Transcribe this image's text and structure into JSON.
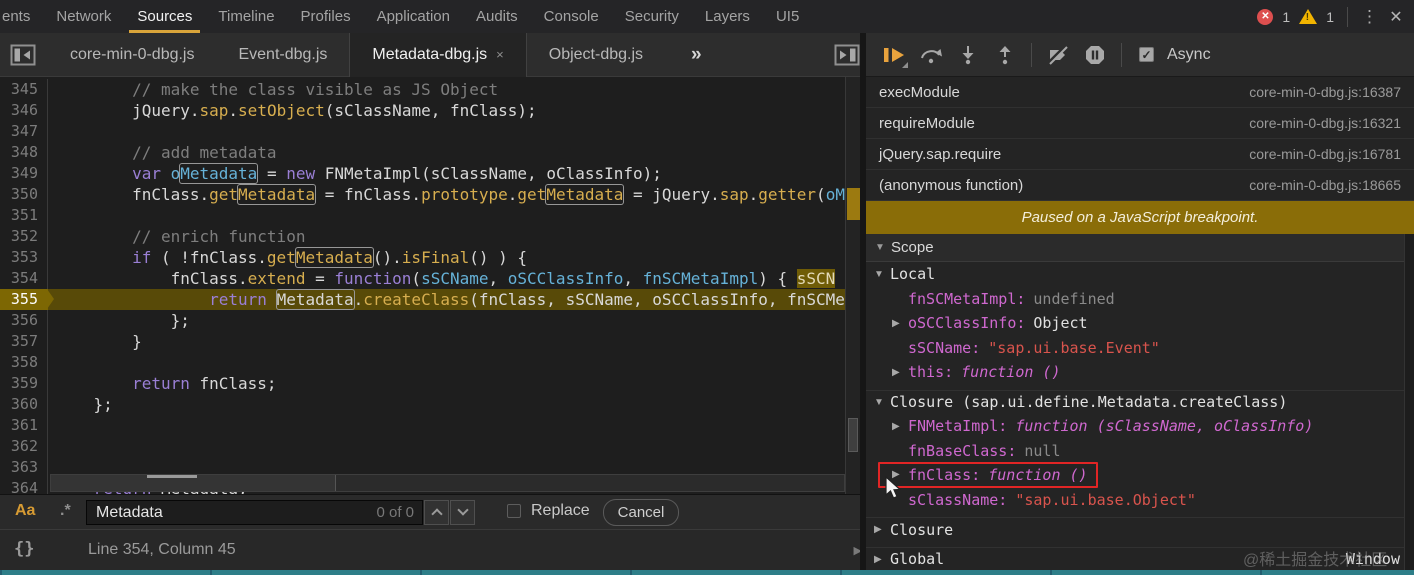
{
  "topbar": {
    "tabs": [
      {
        "label": "ents",
        "active": false
      },
      {
        "label": "Network",
        "active": false
      },
      {
        "label": "Sources",
        "active": true
      },
      {
        "label": "Timeline",
        "active": false
      },
      {
        "label": "Profiles",
        "active": false
      },
      {
        "label": "Application",
        "active": false
      },
      {
        "label": "Audits",
        "active": false
      },
      {
        "label": "Console",
        "active": false
      },
      {
        "label": "Security",
        "active": false
      },
      {
        "label": "Layers",
        "active": false
      },
      {
        "label": "UI5",
        "active": false
      }
    ],
    "error_count": "1",
    "warning_count": "1",
    "warning_glyph": "!",
    "error_glyph": "✕",
    "menu_glyph": "⋮",
    "close_glyph": "✕"
  },
  "file_tabs": {
    "tabs": [
      {
        "label": "core-min-0-dbg.js",
        "active": false
      },
      {
        "label": "Event-dbg.js",
        "active": false
      },
      {
        "label": "Metadata-dbg.js",
        "active": true,
        "close_glyph": "×"
      },
      {
        "label": "Object-dbg.js",
        "active": false
      }
    ],
    "overflow_glyph": "»"
  },
  "editor": {
    "lines": [
      {
        "n": "345",
        "tokens": [
          [
            "t",
            "        "
          ],
          [
            "c",
            "// make the class visible as JS Object"
          ]
        ]
      },
      {
        "n": "346",
        "tokens": [
          [
            "t",
            "        jQuery."
          ],
          [
            "p",
            "sap"
          ],
          [
            "t",
            "."
          ],
          [
            "p",
            "setObject"
          ],
          [
            "t",
            "(sClassName, fnClass);"
          ]
        ]
      },
      {
        "n": "347",
        "tokens": []
      },
      {
        "n": "348",
        "tokens": [
          [
            "t",
            "        "
          ],
          [
            "c",
            "// add metadata"
          ]
        ]
      },
      {
        "n": "349",
        "tokens": [
          [
            "t",
            "        "
          ],
          [
            "k",
            "var"
          ],
          [
            "t",
            " "
          ],
          [
            "d",
            "o"
          ],
          [
            "d m",
            "Metadata"
          ],
          [
            "t",
            " = "
          ],
          [
            "k",
            "new"
          ],
          [
            "t",
            " FNMetaImpl(sClassName, oClassInfo);"
          ]
        ]
      },
      {
        "n": "350",
        "tokens": [
          [
            "t",
            "        fnClass."
          ],
          [
            "p",
            "get"
          ],
          [
            "p m",
            "Metadata"
          ],
          [
            "t",
            " = fnClass."
          ],
          [
            "p",
            "prototype"
          ],
          [
            "t",
            "."
          ],
          [
            "p",
            "get"
          ],
          [
            "p m",
            "Metadata"
          ],
          [
            "t",
            " = jQuery."
          ],
          [
            "p",
            "sap"
          ],
          [
            "t",
            "."
          ],
          [
            "p",
            "getter"
          ],
          [
            "t",
            "("
          ],
          [
            "d",
            "oM"
          ]
        ]
      },
      {
        "n": "351",
        "tokens": []
      },
      {
        "n": "352",
        "tokens": [
          [
            "t",
            "        "
          ],
          [
            "c",
            "// enrich function"
          ]
        ]
      },
      {
        "n": "353",
        "tokens": [
          [
            "t",
            "        "
          ],
          [
            "k",
            "if"
          ],
          [
            "t",
            " ( !fnClass."
          ],
          [
            "p",
            "get"
          ],
          [
            "p m",
            "Metadata"
          ],
          [
            "t",
            "()."
          ],
          [
            "p",
            "isFinal"
          ],
          [
            "t",
            "() ) {"
          ]
        ]
      },
      {
        "n": "354",
        "tokens": [
          [
            "t",
            "            fnClass."
          ],
          [
            "p",
            "extend"
          ],
          [
            "t",
            " = "
          ],
          [
            "k",
            "function"
          ],
          [
            "t",
            "("
          ],
          [
            "d",
            "sSCName"
          ],
          [
            "t",
            ", "
          ],
          [
            "d",
            "oSCClassInfo"
          ],
          [
            "t",
            ", "
          ],
          [
            "d",
            "fnSCMetaImpl"
          ],
          [
            "t",
            ") { "
          ],
          [
            "chip",
            "sSCN"
          ]
        ]
      },
      {
        "n": "355",
        "cur": true,
        "tokens": [
          [
            "t",
            "                "
          ],
          [
            "k",
            "return"
          ],
          [
            "t",
            " "
          ],
          [
            "t m",
            "Metadata"
          ],
          [
            "t",
            "."
          ],
          [
            "p",
            "createClass"
          ],
          [
            "t",
            "(fnClass, sSCName, oSCClassInfo, fnSCMe"
          ]
        ]
      },
      {
        "n": "356",
        "tokens": [
          [
            "t",
            "            };"
          ]
        ]
      },
      {
        "n": "357",
        "tokens": [
          [
            "t",
            "        }"
          ]
        ]
      },
      {
        "n": "358",
        "tokens": []
      },
      {
        "n": "359",
        "tokens": [
          [
            "t",
            "        "
          ],
          [
            "k",
            "return"
          ],
          [
            "t",
            " fnClass;"
          ]
        ]
      },
      {
        "n": "360",
        "tokens": [
          [
            "t",
            "    };"
          ]
        ]
      },
      {
        "n": "361",
        "tokens": []
      },
      {
        "n": "362",
        "tokens": []
      },
      {
        "n": "363",
        "tokens": []
      },
      {
        "n": "364",
        "tokens": [
          [
            "t",
            "    "
          ],
          [
            "k",
            "return"
          ],
          [
            "t",
            " Metadata;"
          ]
        ]
      }
    ]
  },
  "find_bar": {
    "match_case_glyph": "Aa",
    "regex_glyph": ".*",
    "query": "Metadata",
    "results": "0 of 0",
    "replace_label": "Replace",
    "cancel_label": "Cancel"
  },
  "status_bar": {
    "pretty_print_glyph": "{}",
    "position": "Line 354, Column 45"
  },
  "debugger": {
    "async_label": "Async",
    "async_check_glyph": "✓",
    "paused_message": "Paused on a JavaScript breakpoint.",
    "call_stack": [
      {
        "fn": "execModule",
        "loc": "core-min-0-dbg.js:16387"
      },
      {
        "fn": "requireModule",
        "loc": "core-min-0-dbg.js:16321"
      },
      {
        "fn": "jQuery.sap.require",
        "loc": "core-min-0-dbg.js:16781"
      },
      {
        "fn": "(anonymous function)",
        "loc": "core-min-0-dbg.js:18665"
      }
    ],
    "scope_title": "Scope",
    "scope_rows": [
      {
        "kind": "section",
        "arrow": "▼",
        "label": "Local"
      },
      {
        "kind": "item",
        "name": "fnSCMetaImpl:",
        "value": "undefined",
        "vtype": "muted"
      },
      {
        "kind": "item",
        "arrow": "▶",
        "name": "oSCClassInfo:",
        "value": "Object",
        "vtype": "plain"
      },
      {
        "kind": "item",
        "name": "sSCName:",
        "value": "\"sap.ui.base.Event\"",
        "vtype": "string"
      },
      {
        "kind": "item",
        "arrow": "▶",
        "name": "this:",
        "value": "function ()",
        "vtype": "function"
      },
      {
        "kind": "section",
        "arrow": "▼",
        "label": "Closure (sap.ui.define.Metadata.createClass)"
      },
      {
        "kind": "item",
        "arrow": "▶",
        "name": "FNMetaImpl:",
        "value": "function (sClassName, oClassInfo)",
        "vtype": "function"
      },
      {
        "kind": "item",
        "name": "fnBaseClass:",
        "value": "null",
        "vtype": "muted"
      },
      {
        "kind": "item",
        "arrow": "▶",
        "name": "fnClass:",
        "value": "function ()",
        "vtype": "function",
        "highlight": true
      },
      {
        "kind": "item",
        "name": "sClassName:",
        "value": "\"sap.ui.base.Object\"",
        "vtype": "string"
      },
      {
        "kind": "section",
        "arrow": "▶",
        "label": "Closure"
      },
      {
        "kind": "section",
        "arrow": "▶",
        "label": "Global",
        "right": "Window"
      }
    ]
  },
  "watermark": "@稀土掘金技术社区",
  "colors": {
    "accent_orange": "#d9a43a",
    "paused_line": "#584a08",
    "paused_banner": "#8a6d08",
    "error_red": "#dd4f4f",
    "warning_yellow": "#f2b400",
    "breakpoint_box_red": "#e12525",
    "bottom_strip_teal": "#2e7e88"
  }
}
